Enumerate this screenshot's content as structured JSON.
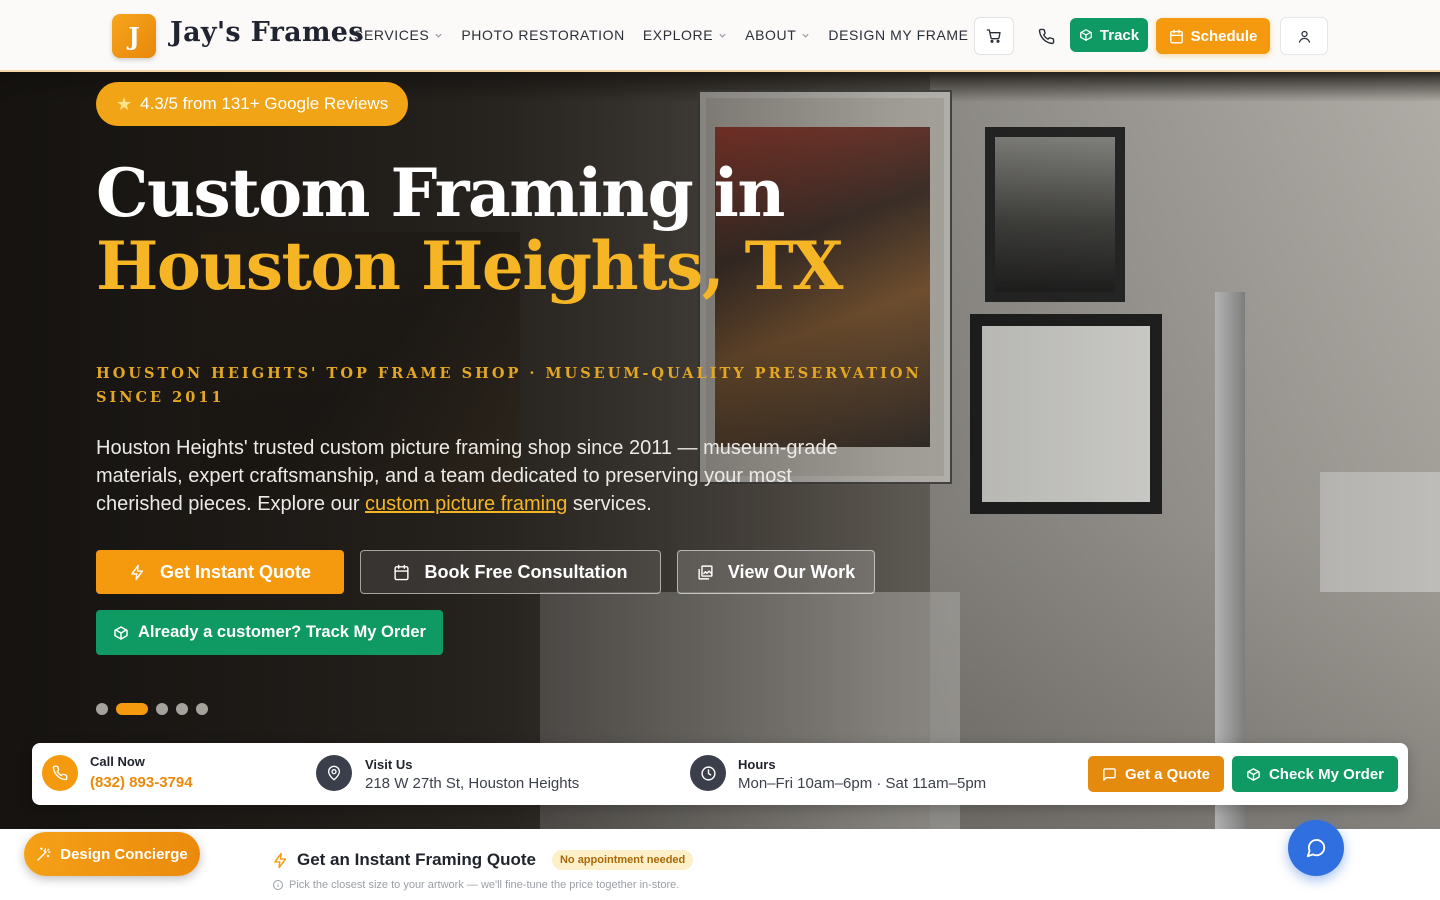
{
  "brand": {
    "logo_letter": "J",
    "name": "Jay's Frames",
    "accent": "#f59a0e",
    "green": "#0f9a63",
    "gold_text": "#f5b524"
  },
  "nav": {
    "items": [
      {
        "label": "SERVICES",
        "dropdown": true
      },
      {
        "label": "PHOTO RESTORATION",
        "dropdown": false
      },
      {
        "label": "EXPLORE",
        "dropdown": true
      },
      {
        "label": "ABOUT",
        "dropdown": true
      },
      {
        "label": "DESIGN MY FRAME",
        "dropdown": true
      }
    ],
    "icons": [
      "shopping-cart-icon",
      "phone-icon",
      "user-icon"
    ],
    "track_label": "Track",
    "schedule_label": "Schedule"
  },
  "hero": {
    "rating_text": "4.3/5 from 131+ Google Reviews",
    "title_line1": "Custom Framing in",
    "title_line2": "Houston Heights, TX",
    "tagline": "HOUSTON HEIGHTS' TOP FRAME SHOP · MUSEUM-QUALITY PRESERVATION SINCE 2011",
    "lead_before": "Houston Heights' trusted custom picture framing shop since 2011 — museum-grade materials, expert craftsmanship, and a team dedicated to preserving your most cherished pieces. Explore our ",
    "lead_link": "custom picture framing",
    "lead_after": " services.",
    "buttons": {
      "instant_quote": "Get Instant Quote",
      "consultation": "Book Free Consultation",
      "view_work": "View Our Work",
      "track_order": "Already a customer? Track My Order"
    },
    "slides": {
      "count": 5,
      "active": 2
    }
  },
  "info_bar": {
    "call": {
      "title": "Call Now",
      "value": "(832) 893-3794"
    },
    "visit": {
      "title": "Visit Us",
      "value": "218 W 27th St, Houston Heights"
    },
    "hours": {
      "title": "Hours",
      "value": "Mon–Fri 10am–6pm · Sat 11am–5pm"
    },
    "get_quote": "Get a Quote",
    "check_order": "Check My Order"
  },
  "bottom": {
    "concierge_label": "Design Concierge",
    "quote_title": "Get an Instant Framing Quote",
    "quote_badge": "No appointment needed",
    "quote_hint": "Pick the closest size to your artwork — we'll fine-tune the price together in-store."
  }
}
